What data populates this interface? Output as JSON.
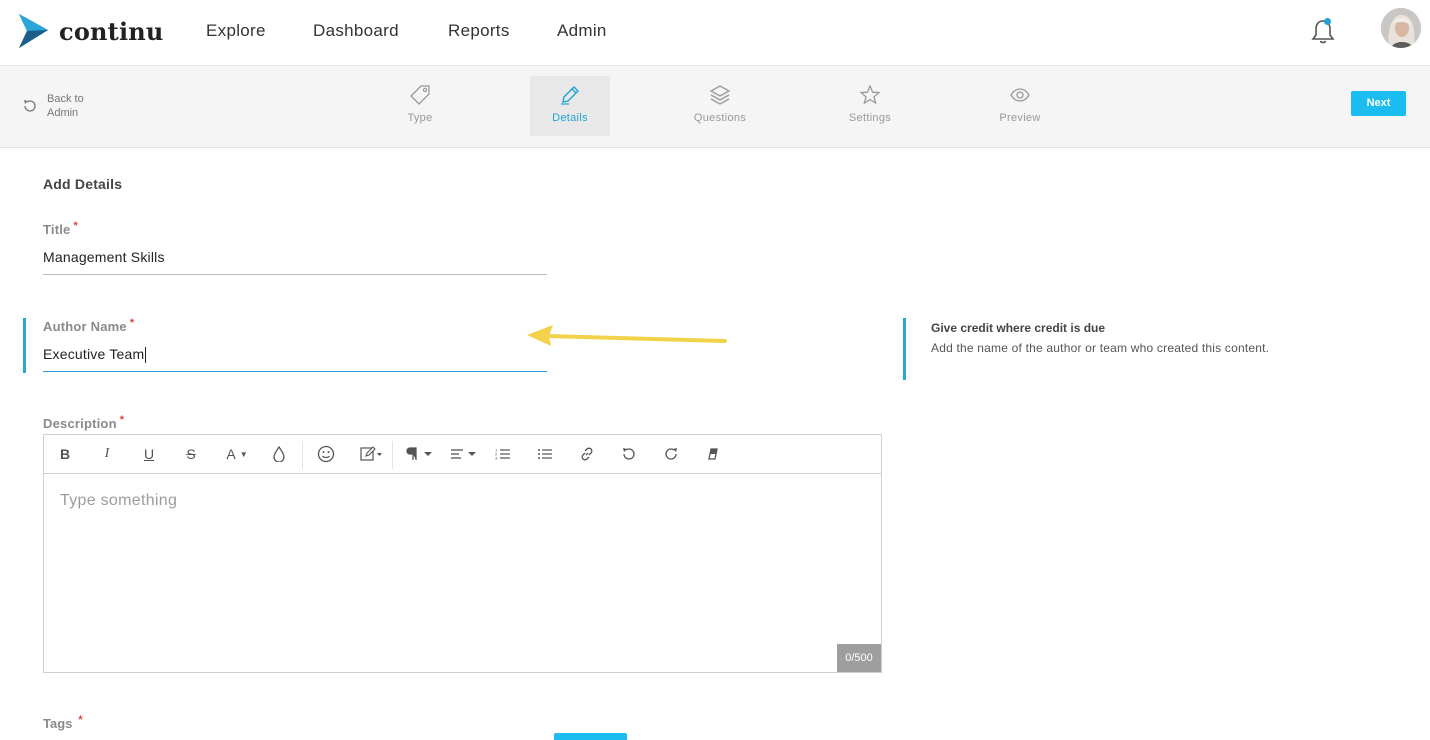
{
  "app": {
    "brand": "continu",
    "accent_color": "#1bbcef",
    "nav": [
      {
        "label": "Explore"
      },
      {
        "label": "Dashboard"
      },
      {
        "label": "Reports"
      },
      {
        "label": "Admin"
      }
    ],
    "icons": {
      "notifications": "bell-icon",
      "user": "avatar"
    }
  },
  "stepper": {
    "back_label": "Back to Admin",
    "steps": [
      {
        "label": "Type",
        "icon": "tag-icon",
        "active": false
      },
      {
        "label": "Details",
        "icon": "pencil-icon",
        "active": true
      },
      {
        "label": "Questions",
        "icon": "layers-icon",
        "active": false
      },
      {
        "label": "Settings",
        "icon": "star-icon",
        "active": false
      },
      {
        "label": "Preview",
        "icon": "eye-icon",
        "active": false
      }
    ],
    "next_label": "Next"
  },
  "form": {
    "section_title": "Add Details",
    "title_field": {
      "label": "Title",
      "required_mark": "*",
      "value": "Management Skills"
    },
    "author_field": {
      "label": "Author Name",
      "required_mark": "*",
      "value": "Executive Team"
    },
    "help": {
      "title": "Give credit where credit is due",
      "text": "Add the name of the author or team who created this content."
    },
    "description_field": {
      "label": "Description",
      "required_mark": "*",
      "placeholder": "Type something",
      "counter": "0/500",
      "toolbar": [
        "bold-icon",
        "italic-icon",
        "underline-icon",
        "strikethrough-icon",
        "font-color-icon",
        "fill-color-icon",
        "emoji-icon",
        "edit-icon",
        "paragraph-icon",
        "align-icon",
        "ordered-list-icon",
        "unordered-list-icon",
        "link-icon",
        "undo-icon",
        "redo-icon",
        "clear-format-icon"
      ]
    },
    "tags_field": {
      "label": "Tags",
      "required_mark": "*"
    }
  }
}
